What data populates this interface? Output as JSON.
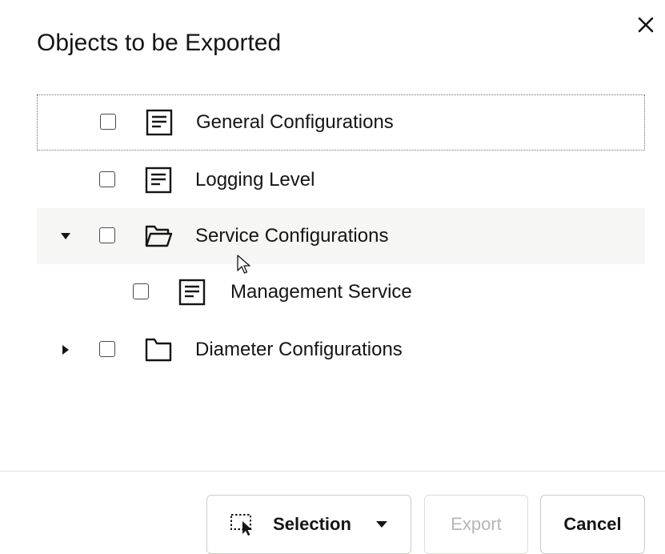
{
  "dialog": {
    "title": "Objects to be Exported",
    "close_icon": "close-icon"
  },
  "tree": {
    "items": [
      {
        "label": "General Configurations",
        "type": "document",
        "icon": "document-icon",
        "checked": false,
        "expandable": false,
        "focused": true
      },
      {
        "label": "Logging Level",
        "type": "document",
        "icon": "document-icon",
        "checked": false,
        "expandable": false
      },
      {
        "label": "Service Configurations",
        "type": "folder",
        "icon": "folder-open-icon",
        "checked": false,
        "expandable": true,
        "expanded": true
      },
      {
        "label": "Management Service",
        "type": "document",
        "icon": "document-icon",
        "checked": false,
        "expandable": false,
        "level": 2
      },
      {
        "label": "Diameter Configurations",
        "type": "folder",
        "icon": "folder-icon",
        "checked": false,
        "expandable": true,
        "expanded": false
      }
    ]
  },
  "footer": {
    "selection_label": "Selection",
    "export_label": "Export",
    "cancel_label": "Cancel"
  }
}
